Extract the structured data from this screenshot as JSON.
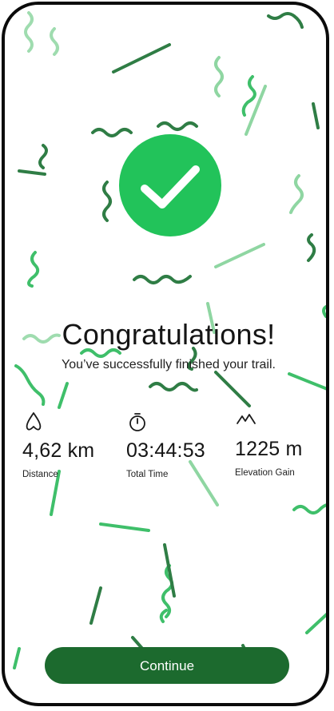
{
  "title": "Congratulations!",
  "subtitle": "You’ve successfully finished your trail.",
  "stats": [
    {
      "icon": "distance-icon",
      "value": "4,62 km",
      "label": "Distance"
    },
    {
      "icon": "stopwatch-icon",
      "value": "03:44:53",
      "label": "Total Time"
    },
    {
      "icon": "mountain-icon",
      "value": "1225 m",
      "label": "Elevation Gain"
    }
  ],
  "continue_label": "Continue",
  "colors": {
    "badge": "#22c35a",
    "button": "#1c6a2e",
    "confetti_dark": "#2f7d45",
    "confetti_mid": "#3fbf6a",
    "confetti_light": "#8fd6a2"
  }
}
